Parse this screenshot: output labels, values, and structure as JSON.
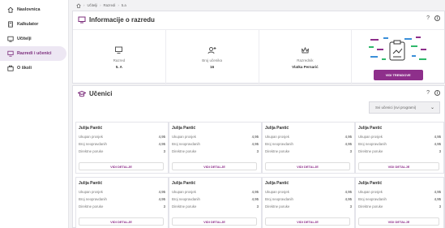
{
  "sidebar": {
    "items": [
      {
        "label": "Naslovnica",
        "icon": "home-icon"
      },
      {
        "label": "Kalkulator",
        "icon": "calculator-icon"
      },
      {
        "label": "Učitelji",
        "icon": "teachers-icon"
      },
      {
        "label": "Razredi i učenici",
        "icon": "classes-icon",
        "active": true
      },
      {
        "label": "O školi",
        "icon": "school-icon"
      }
    ]
  },
  "breadcrumb": [
    "Učitelji",
    "Razredi",
    "5.a"
  ],
  "info_panel": {
    "title": "Informacije o razredu",
    "cells": [
      {
        "label": "Razred",
        "value": "5. A",
        "icon": "class-icon"
      },
      {
        "label": "Broj učenika",
        "value": "16",
        "icon": "add-user-icon"
      },
      {
        "label": "Razrednik",
        "value": "Vlatka Pernarić",
        "icon": "crown-icon"
      }
    ],
    "trend_button": "VIDI TRENDOVE"
  },
  "students_panel": {
    "title": "Učenici",
    "filter": "Svi učenici (svi programi)",
    "row_labels": [
      "Ukupan prosjek",
      "Broj neopravdanih",
      "Direktne poruke"
    ],
    "button": "VIDI DETALJE",
    "students": [
      {
        "name": "Julija Pantić",
        "values": [
          "4,95",
          "4,95",
          "3"
        ]
      },
      {
        "name": "Julija Pantić",
        "values": [
          "4,95",
          "4,95",
          "3"
        ]
      },
      {
        "name": "Julija Pantić",
        "values": [
          "4,95",
          "4,95",
          "3"
        ]
      },
      {
        "name": "Julija Pantić",
        "values": [
          "4,95",
          "4,95",
          "3"
        ]
      },
      {
        "name": "Julija Pantić",
        "values": [
          "4,95",
          "4,95",
          "3"
        ]
      },
      {
        "name": "Julija Pantić",
        "values": [
          "4,95",
          "4,95",
          "3"
        ]
      },
      {
        "name": "Julija Pantić",
        "values": [
          "4,95",
          "4,95",
          "3"
        ]
      },
      {
        "name": "Julija Pantić",
        "values": [
          "4,95",
          "4,95",
          "3"
        ]
      }
    ]
  },
  "colors": {
    "accent": "#8e2f8b",
    "active_bg": "#ede7f3"
  }
}
